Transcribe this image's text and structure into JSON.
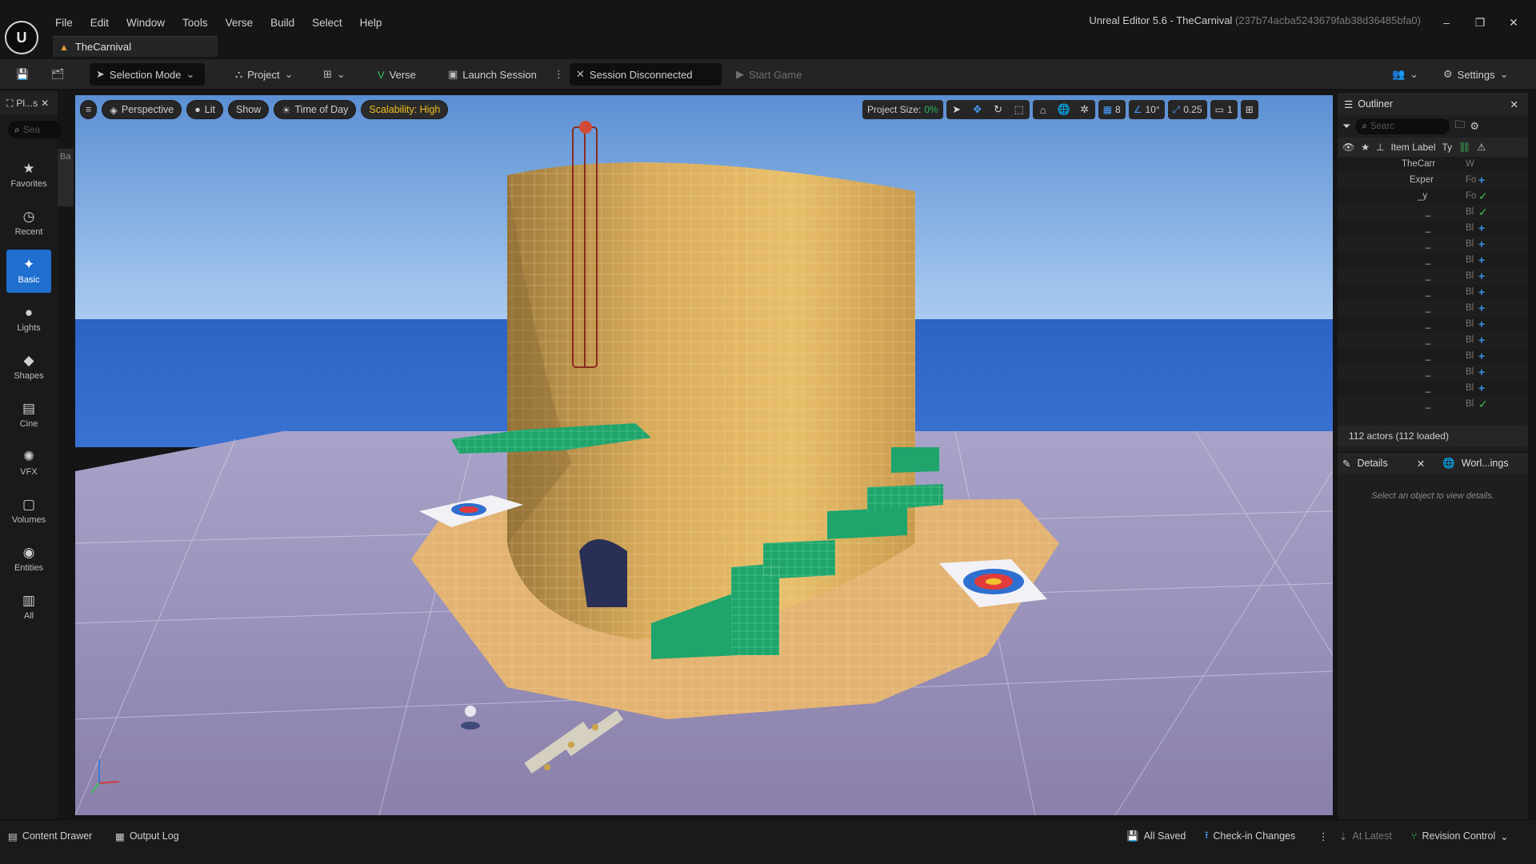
{
  "window": {
    "title": "Unreal Editor 5.6 - TheCarnival",
    "hash": "(237b74acba5243679fab38d36485bfa0)",
    "logo_text": "U",
    "minimize_glyph": "–",
    "restore_glyph": "❐",
    "close_glyph": "✕"
  },
  "menu": [
    "File",
    "Edit",
    "Window",
    "Tools",
    "Verse",
    "Build",
    "Select",
    "Help"
  ],
  "document_tab": {
    "label": "TheCarnival",
    "icon": "level-warning-icon"
  },
  "toolbar": {
    "selection_mode": "Selection Mode",
    "project": "Project",
    "verse": "Verse",
    "launch_session": "Launch Session",
    "session_status": "Session Disconnected",
    "start_game": "Start Game",
    "settings": "Settings"
  },
  "place_panel": {
    "tab_label": "Pl...s",
    "search_placeholder": "Sea",
    "asset_tab_stub": "Ba",
    "categories": [
      {
        "label": "Favorites",
        "icon": "star-icon"
      },
      {
        "label": "Recent",
        "icon": "clock-icon"
      },
      {
        "label": "Basic",
        "icon": "basic-icon",
        "active": true
      },
      {
        "label": "Lights",
        "icon": "lightbulb-icon"
      },
      {
        "label": "Shapes",
        "icon": "shapes-icon"
      },
      {
        "label": "Cine",
        "icon": "clapper-icon"
      },
      {
        "label": "VFX",
        "icon": "sparkle-icon"
      },
      {
        "label": "Volumes",
        "icon": "volume-icon"
      },
      {
        "label": "Entities",
        "icon": "entity-icon"
      },
      {
        "label": "All",
        "icon": "all-icon"
      }
    ]
  },
  "viewport": {
    "perspective": "Perspective",
    "lit": "Lit",
    "show": "Show",
    "time_of_day": "Time of Day",
    "scalability": "Scalability: High",
    "project_size_label": "Project Size:",
    "project_size_value": "0%",
    "grid_snap": "8",
    "rotation_snap": "10°",
    "scale_snap": "0.25",
    "camera_speed": "1",
    "accent_blue": "#4a9cff",
    "accent_green": "#2fb35c",
    "scalability_color": "#f0c020"
  },
  "outliner": {
    "title": "Outliner",
    "search_placeholder": "Searc",
    "column_label": "Item Label",
    "column_type": "Ty",
    "rows": [
      {
        "label": "TheCarr",
        "type": "W",
        "status": ""
      },
      {
        "label": "Exper",
        "type": "Fo",
        "status": "+"
      },
      {
        "label": "_y",
        "type": "Fo",
        "status": "✓"
      },
      {
        "label": "_",
        "type": "Bl",
        "status": "✓"
      },
      {
        "label": "_",
        "type": "Bl",
        "status": "+"
      },
      {
        "label": "_",
        "type": "Bl",
        "status": "+"
      },
      {
        "label": "_",
        "type": "Bl",
        "status": "+"
      },
      {
        "label": "_",
        "type": "Bl",
        "status": "+"
      },
      {
        "label": "_",
        "type": "Bl",
        "status": "+"
      },
      {
        "label": "_",
        "type": "Bl",
        "status": "+"
      },
      {
        "label": "_",
        "type": "Bl",
        "status": "+"
      },
      {
        "label": "_",
        "type": "Bl",
        "status": "+"
      },
      {
        "label": "_",
        "type": "Bl",
        "status": "+"
      },
      {
        "label": "_",
        "type": "Bl",
        "status": "+"
      },
      {
        "label": "_",
        "type": "Bl",
        "status": "+"
      },
      {
        "label": "_",
        "type": "Bl",
        "status": "✓"
      }
    ],
    "actor_count": "112 actors (112 loaded)"
  },
  "details": {
    "tab_details": "Details",
    "tab_world": "Worl...ings",
    "empty_message": "Select an object to view details."
  },
  "statusbar": {
    "content_drawer": "Content Drawer",
    "output_log": "Output Log",
    "all_saved": "All Saved",
    "check_in": "Check-in Changes",
    "at_latest": "At Latest",
    "revision_control": "Revision Control"
  }
}
